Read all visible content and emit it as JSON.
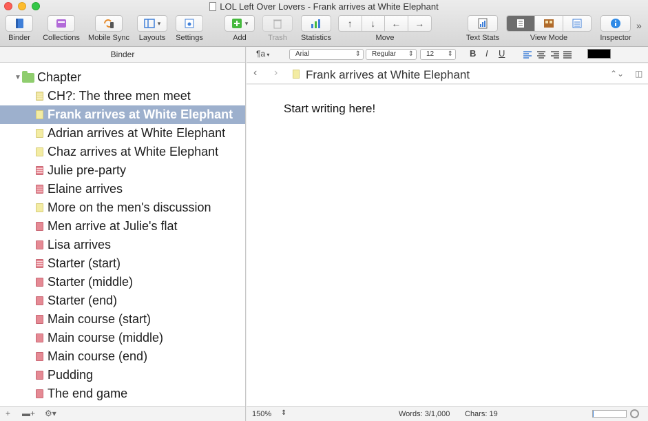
{
  "window": {
    "title": "LOL Left Over Lovers - Frank arrives at White Elephant"
  },
  "toolbar": {
    "binder": "Binder",
    "collections": "Collections",
    "mobile_sync": "Mobile Sync",
    "layouts": "Layouts",
    "settings": "Settings",
    "add": "Add",
    "trash": "Trash",
    "statistics": "Statistics",
    "move": "Move",
    "text_stats": "Text Stats",
    "view_mode": "View Mode",
    "inspector": "Inspector",
    "more": "»"
  },
  "binder": {
    "header": "Binder",
    "folder": "Chapter",
    "items": [
      {
        "label": "CH?: The three men meet",
        "card": "yellowlined",
        "selected": false
      },
      {
        "label": "Frank arrives at White Elephant",
        "card": "yellow",
        "selected": true
      },
      {
        "label": "Adrian arrives at White Elephant",
        "card": "yellow",
        "selected": false
      },
      {
        "label": "Chaz arrives at White Elephant",
        "card": "yellow",
        "selected": false
      },
      {
        "label": "Julie pre-party",
        "card": "redlined",
        "selected": false
      },
      {
        "label": "Elaine arrives",
        "card": "redlined",
        "selected": false
      },
      {
        "label": "More on the men's discussion",
        "card": "yellow",
        "selected": false
      },
      {
        "label": "Men arrive at Julie's flat",
        "card": "red",
        "selected": false
      },
      {
        "label": "Lisa arrives",
        "card": "red",
        "selected": false
      },
      {
        "label": "Starter (start)",
        "card": "redlined",
        "selected": false
      },
      {
        "label": "Starter (middle)",
        "card": "red",
        "selected": false
      },
      {
        "label": "Starter (end)",
        "card": "red",
        "selected": false
      },
      {
        "label": "Main course (start)",
        "card": "red",
        "selected": false
      },
      {
        "label": "Main course (middle)",
        "card": "red",
        "selected": false
      },
      {
        "label": "Main course (end)",
        "card": "red",
        "selected": false
      },
      {
        "label": "Pudding",
        "card": "red",
        "selected": false
      },
      {
        "label": "The end game",
        "card": "red",
        "selected": false
      }
    ]
  },
  "formatbar": {
    "para_style": "¶a",
    "font": "Arial",
    "weight": "Regular",
    "size": "12",
    "bold": "B",
    "italic": "I",
    "underline": "U"
  },
  "editor": {
    "doc_title": "Frank arrives at White Elephant",
    "content": "Start writing here!"
  },
  "footer": {
    "zoom": "150%",
    "words": "Words: 3/1,000",
    "chars": "Chars: 19",
    "progress": 0.003
  },
  "colors": {
    "selection": "#9db0cd",
    "folder": "#8fcd6e",
    "card_yellow": "#f3eca3",
    "card_red": "#e58a94"
  }
}
